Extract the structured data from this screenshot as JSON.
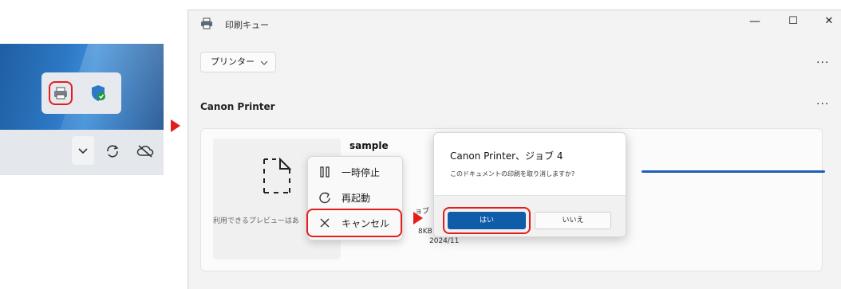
{
  "window": {
    "title": "印刷キュー",
    "minimize_glyph": "—",
    "maximize_glyph": "☐",
    "close_glyph": "✕"
  },
  "toolbar": {
    "printer_dropdown": "プリンター",
    "more_glyph": "···"
  },
  "queue": {
    "printer_name": "Canon Printer",
    "more_glyph": "···",
    "job": {
      "document_name": "sample",
      "preview_text": "利用できるプレビューはあ",
      "info_fragment_1": "ョブ",
      "info_fragment_2": "8KB",
      "info_fragment_3": "2024/11"
    }
  },
  "context_menu": {
    "items": [
      {
        "label": "一時停止",
        "icon": "pause-icon"
      },
      {
        "label": "再起動",
        "icon": "restart-icon"
      },
      {
        "label": "キャンセル",
        "icon": "close-icon"
      }
    ]
  },
  "dialog": {
    "title": "Canon Printer、ジョブ 4",
    "message": "このドキュメントの印刷を取り消しますか?",
    "yes_label": "はい",
    "no_label": "いいえ"
  },
  "colors": {
    "annotation": "#e51c1c",
    "accent": "#0f5ca8",
    "progress": "#1f5fb4"
  }
}
